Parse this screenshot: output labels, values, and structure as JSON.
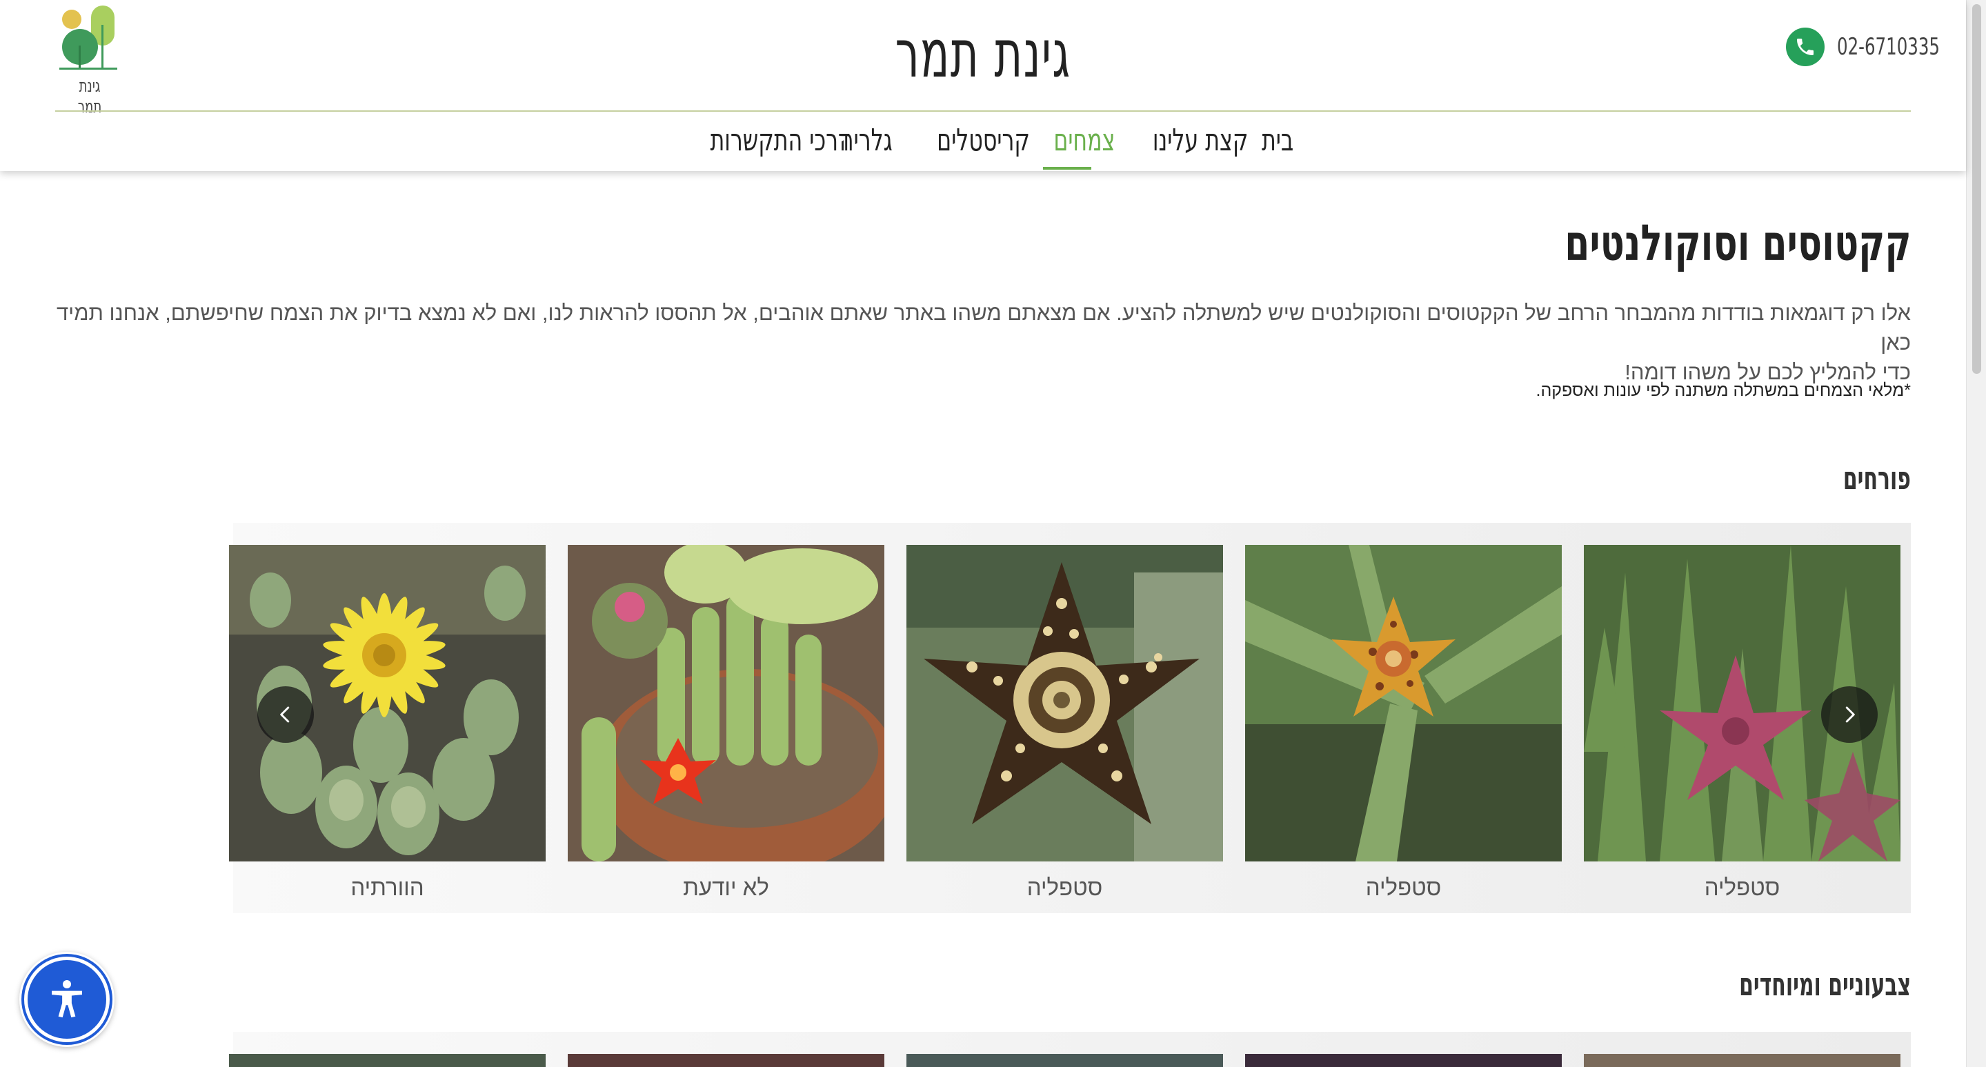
{
  "logo": {
    "text": "גינת תמר"
  },
  "site_title": "גינת תמר",
  "phone": {
    "number": "02-6710335",
    "icon": "phone-icon"
  },
  "nav": {
    "items": [
      {
        "label": "בית",
        "active": false
      },
      {
        "label": "קצת עלינו",
        "active": false
      },
      {
        "label": "צמחים",
        "active": true
      },
      {
        "label": "קריסטלים",
        "active": false
      },
      {
        "label": "גלריה",
        "active": false
      },
      {
        "label": "דרכי התקשרות",
        "active": false
      }
    ]
  },
  "page": {
    "title": "קקטוסים וסוקולנטים",
    "intro_line1": "אלו רק דוגמאות בודדות מהמבחר הרחב של הקקטוסים והסוקולנטים שיש למשתלה להציע. אם מצאתם משהו באתר שאתם אוהבים, אל תהססו להראות לנו, ואם לא נמצא בדיוק את הצמח שחיפשתם, אנחנו תמיד כאן",
    "intro_line2": "כדי להמליץ לכם על משהו דומה!",
    "note": "*מלאי הצמחים במשתלה משתנה לפי עונות ואספקה."
  },
  "sections": [
    {
      "title": "פורחים",
      "items": [
        {
          "label": "סטפליה"
        },
        {
          "label": "סטפליה"
        },
        {
          "label": "סטפליה"
        },
        {
          "label": "לא יודעת"
        },
        {
          "label": "הוורתיה"
        }
      ]
    },
    {
      "title": "צבעוניים ומיוחדים",
      "items": []
    }
  ],
  "icons": {
    "prev": "chevron-left-icon",
    "next": "chevron-right-icon",
    "accessibility": "accessibility-icon"
  },
  "colors": {
    "accent_green": "#6ab04c",
    "phone_green": "#26a05a",
    "accessibility_blue": "#1f5bd6"
  }
}
